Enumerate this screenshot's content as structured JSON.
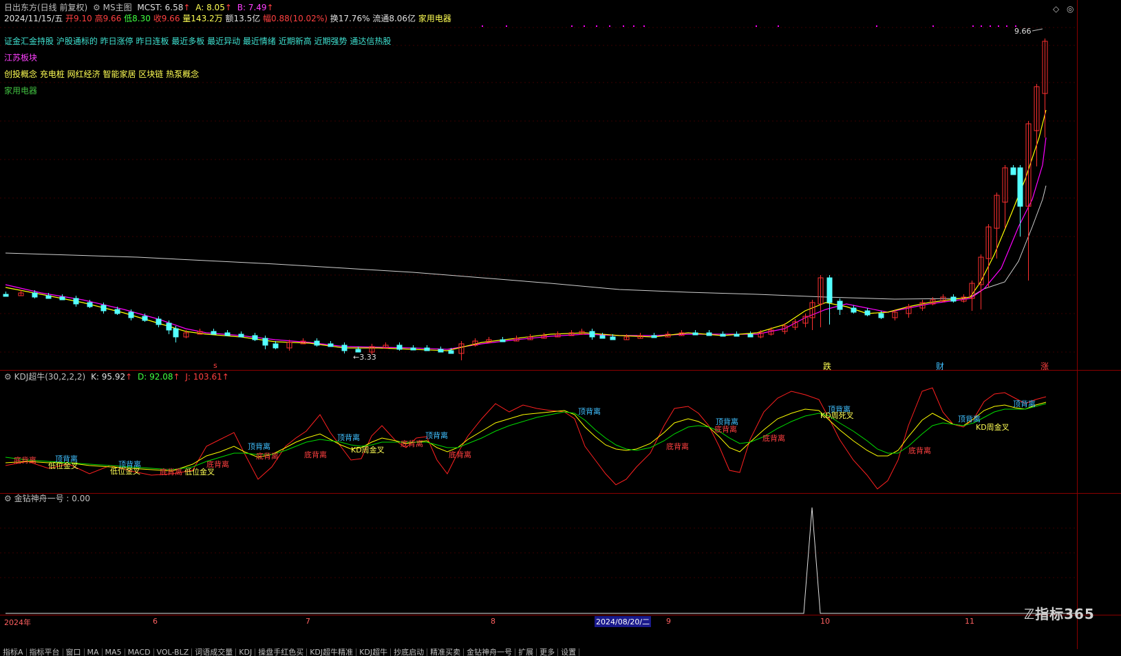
{
  "header": {
    "stock_name": "日出东方(日线 前复权)",
    "indicator": "MS主图",
    "mcst_label": "MCST: 6.58",
    "a_label": "A: 8.05",
    "b_label": "B: 7.49",
    "date": "2024/11/15/五",
    "open": "开9.10",
    "high": "高9.66",
    "low": "低8.30",
    "close": "收9.66",
    "volume": "量143.2万",
    "amount": "额13.5亿",
    "change": "幅0.88(10.02%)",
    "turnover": "换17.76%",
    "float": "流通8.06亿",
    "industry": "家用电器"
  },
  "concept_lines": [
    {
      "text": "证金汇金持股 沪股通标的 昨日涨停 昨日连板 最近多板 最近异动 最近情绪 近期新高 近期强势 通达信热股",
      "color": "#40e0d0"
    },
    {
      "text": "江苏板块",
      "color": "#ff40ff"
    },
    {
      "text": "创投概念 充电桩 网红经济 智能家居 区块链 热泵概念",
      "color": "#ffff54"
    },
    {
      "text": "家用电器",
      "color": "#40c040"
    }
  ],
  "price_labels": {
    "high": "9.66",
    "low": "3.33"
  },
  "signal_labels": [
    {
      "text": "跌",
      "color": "#ffff54"
    },
    {
      "text": "财",
      "color": "#40c0ff"
    },
    {
      "text": "涨",
      "color": "#ff4040"
    },
    {
      "text": "s",
      "color": "#ff4040"
    }
  ],
  "kdj": {
    "title": "KDJ超牛(30,2,2,2)",
    "k_label": "K: 95.92",
    "d_label": "D: 92.08",
    "j_label": "J: 103.61",
    "annotations": [
      {
        "text": "底背离",
        "color": "#ff4040"
      },
      {
        "text": "顶背离",
        "color": "#40c0ff"
      },
      {
        "text": "低位金叉",
        "color": "#ffff54"
      },
      {
        "text": "顶背离",
        "color": "#40c0ff"
      },
      {
        "text": "低位金叉",
        "color": "#ffff54"
      },
      {
        "text": "底背离",
        "color": "#ff4040"
      },
      {
        "text": "低位金叉",
        "color": "#ffff54"
      },
      {
        "text": "底背离",
        "color": "#ff4040"
      },
      {
        "text": "顶背离",
        "color": "#40c0ff"
      },
      {
        "text": "底背离",
        "color": "#ff4040"
      },
      {
        "text": "底背离",
        "color": "#ff4040"
      },
      {
        "text": "顶背离",
        "color": "#40c0ff"
      },
      {
        "text": "KD周金叉",
        "color": "#ffff54"
      },
      {
        "text": "底背离",
        "color": "#ff4040"
      },
      {
        "text": "顶背离",
        "color": "#40c0ff"
      },
      {
        "text": "底背离",
        "color": "#ff4040"
      },
      {
        "text": "顶背离",
        "color": "#40c0ff"
      },
      {
        "text": "底背离",
        "color": "#ff4040"
      },
      {
        "text": "顶背离",
        "color": "#40c0ff"
      },
      {
        "text": "底背离",
        "color": "#ff4040"
      },
      {
        "text": "底背离",
        "color": "#ff4040"
      },
      {
        "text": "顶背离",
        "color": "#40c0ff"
      },
      {
        "text": "KD周死叉",
        "color": "#ffff54"
      },
      {
        "text": "底背离",
        "color": "#ff4040"
      },
      {
        "text": "顶背离",
        "color": "#40c0ff"
      },
      {
        "text": "KD周金叉",
        "color": "#ffff54"
      },
      {
        "text": "顶背离",
        "color": "#40c0ff"
      }
    ]
  },
  "jzsz": {
    "title": "金钻神舟一号 : 0.00"
  },
  "xaxis": {
    "labels": [
      "2024年",
      "6",
      "7",
      "8",
      "2024/08/20/二",
      "9",
      "10",
      "11"
    ]
  },
  "bottom_tabs": [
    "指标A",
    "指标平台",
    "窗口",
    "MA",
    "MA5",
    "MACD",
    "VOL-BLZ",
    "词语成交量",
    "KDJ",
    "操盘手红色买",
    "KDJ超牛精准",
    "KDJ超牛",
    "抄底启动",
    "精准买卖",
    "金钻神舟一号",
    "扩展",
    "更多",
    "设置"
  ],
  "watermark": "指标365"
}
